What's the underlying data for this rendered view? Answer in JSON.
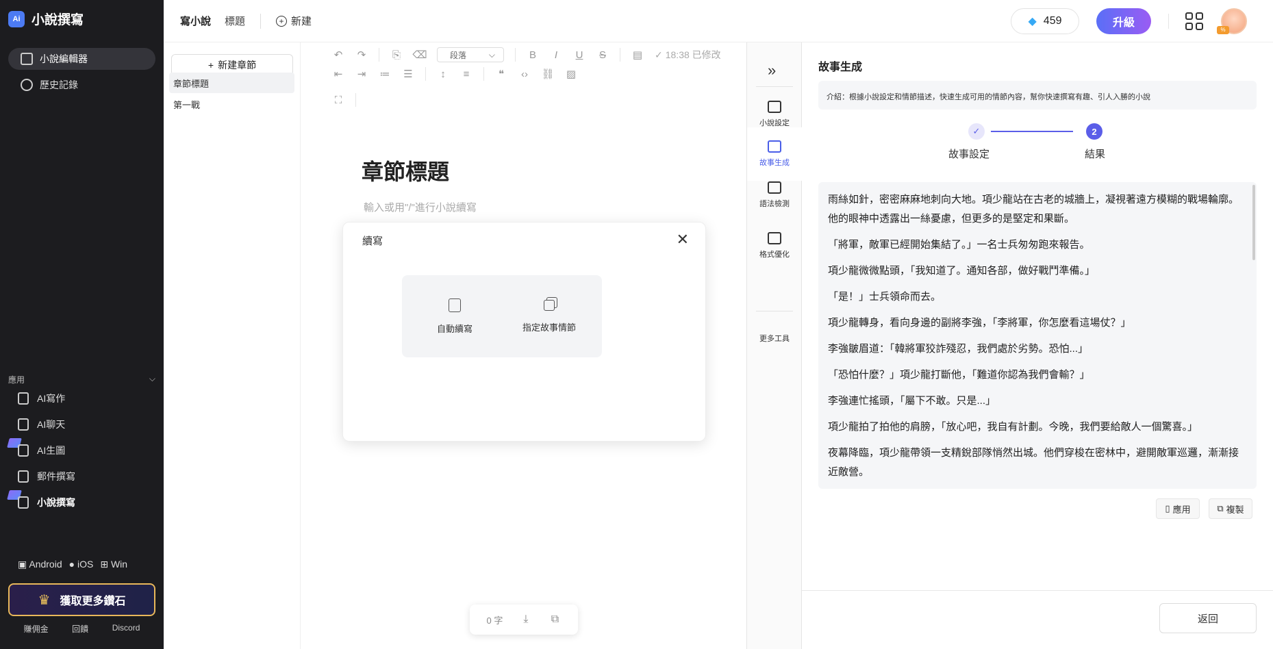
{
  "app": {
    "logo_mark": "Ai",
    "name": "小說撰寫"
  },
  "sidebar": {
    "nav": [
      {
        "label": "小說編輯器",
        "icon": "edit-icon"
      },
      {
        "label": "歷史記錄",
        "icon": "clock-icon"
      }
    ],
    "apps_header": "應用",
    "apps": [
      {
        "label": "AI寫作",
        "icon": "writing-icon"
      },
      {
        "label": "AI聊天",
        "icon": "chat-icon"
      },
      {
        "label": "AI生圖",
        "icon": "image-icon"
      },
      {
        "label": "郵件撰寫",
        "icon": "mail-icon"
      },
      {
        "label": "小說撰寫",
        "icon": "novel-icon"
      }
    ],
    "platforms": [
      "Android",
      "iOS",
      "Win"
    ],
    "diamond_button": "獲取更多鑽石",
    "bottom_links": [
      "賺佣金",
      "回饋",
      "Discord"
    ]
  },
  "header": {
    "tabs": [
      "寫小說",
      "標題"
    ],
    "new_label": "新建",
    "diamonds": "459",
    "upgrade_label": "升級",
    "avatar_badge": "%"
  },
  "chapters": {
    "new_label": "新建章節",
    "items": [
      "章節標題",
      "第一戰"
    ]
  },
  "editor": {
    "paragraph_select": "段落",
    "saved_status": "18:38 已修改",
    "title": "章節標題",
    "placeholder": "輸入或用\"/\"進行小說續寫",
    "word_count": "0 字"
  },
  "modal": {
    "title": "續寫",
    "options": [
      "自動續寫",
      "指定故事情節"
    ]
  },
  "rail": {
    "items": [
      "小說設定",
      "故事生成",
      "語法檢測",
      "格式優化"
    ],
    "more_label": "更多工具"
  },
  "panel": {
    "title": "故事生成",
    "intro": "介紹：根據小說設定和情節描述，快速生成可用的情節內容，幫你快速撰寫有趣、引人入勝的小說",
    "steps": [
      "故事設定",
      "結果"
    ],
    "step_current_number": "2",
    "paragraphs": [
      "雨絲如針，密密麻麻地刺向大地。項少龍站在古老的城牆上，凝視著遠方模糊的戰場輪廓。他的眼神中透露出一絲憂慮，但更多的是堅定和果斷。",
      "「將軍，敵軍已經開始集結了。」一名士兵匆匆跑來報告。",
      "項少龍微微點頭，「我知道了。通知各部，做好戰鬥準備。」",
      "「是！」士兵領命而去。",
      "項少龍轉身，看向身邊的副將李強，「李將軍，你怎麼看這場仗？」",
      "李強皺眉道：「韓將軍狡詐殘忍，我們處於劣勢。恐怕...」",
      "「恐怕什麼？」項少龍打斷他，「難道你認為我們會輸？」",
      "李強連忙搖頭，「屬下不敢。只是...」",
      "項少龍拍了拍他的肩膀，「放心吧，我自有計劃。今晚，我們要給敵人一個驚喜。」",
      "夜幕降臨，項少龍帶領一支精銳部隊悄然出城。他們穿梭在密林中，避開敵軍巡邏，漸漸接近敵營。"
    ],
    "apply_label": "應用",
    "copy_label": "複製",
    "back_label": "返回"
  }
}
